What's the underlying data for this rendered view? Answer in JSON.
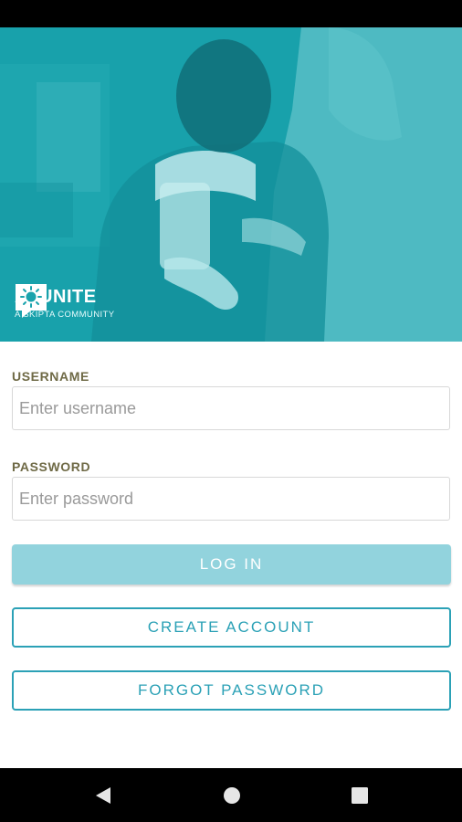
{
  "brand": {
    "title": "AI UNITE",
    "subtitle": "A SKIPTA COMMUNITY"
  },
  "form": {
    "username_label": "USERNAME",
    "username_placeholder": "Enter username",
    "username_value": "",
    "password_label": "PASSWORD",
    "password_placeholder": "Enter password",
    "password_value": ""
  },
  "buttons": {
    "login": "LOG IN",
    "create_account": "CREATE ACCOUNT",
    "forgot_password": "FORGOT PASSWORD"
  },
  "nav": {
    "back": "back-icon",
    "home": "home-icon",
    "recents": "recents-icon"
  },
  "colors": {
    "brand_teal": "#1aa3ad",
    "label_olive": "#6f6a46",
    "login_bg": "#92d3dd",
    "outline_teal": "#2ba1b6"
  }
}
